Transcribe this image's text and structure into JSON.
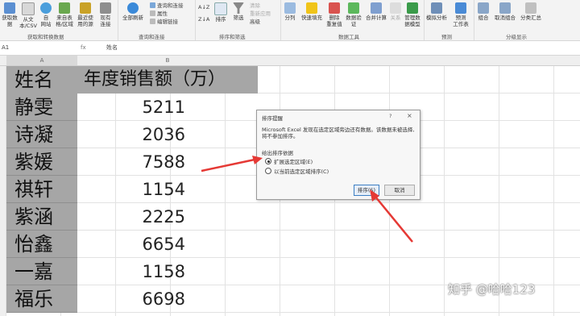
{
  "ribbon": {
    "groups": {
      "get_data": {
        "label": "获取和转换数据"
      },
      "queries": {
        "label": "查询和连接"
      },
      "sort_filter": {
        "label": "排序和筛选"
      },
      "data_tools": {
        "label": "数据工具"
      },
      "forecast": {
        "label": "预测"
      },
      "outline": {
        "label": "分级显示"
      }
    },
    "buttons": {
      "get_data": "获取数\n据",
      "from_text": "从文\n本/CSV",
      "from_web": "自\n网站",
      "from_table": "来自表\n格/区域",
      "recent": "最近使\n用的源",
      "existing": "现有\n连接",
      "refresh_all": "全部刷新",
      "queries_conn": "查询和连接",
      "properties": "属性",
      "edit_links": "编辑链接",
      "sort_asc": "A↓Z",
      "sort_desc": "Z↓A",
      "sort": "排序",
      "filter": "筛选",
      "clear": "清除",
      "reapply": "重新应用",
      "advanced": "高级",
      "text_to_cols": "分列",
      "flash_fill": "快速填充",
      "remove_dup": "删除\n重复值",
      "validation": "数据验\n证",
      "consolidate": "合并计算",
      "relations": "关系",
      "data_model": "管理数\n据模型",
      "what_if": "模拟分析",
      "forecast_sheet": "预测\n工作表",
      "group": "组合",
      "ungroup": "取消组合",
      "subtotal": "分类汇总"
    }
  },
  "formula_bar": {
    "cell_ref": "A1",
    "fx": "fx",
    "content": "姓名"
  },
  "columns": {
    "a": "A",
    "b": "B"
  },
  "table": {
    "header": {
      "name": "姓名",
      "sales": "年度销售额（万）"
    },
    "rows": [
      {
        "name": "静雯",
        "sales": "5211"
      },
      {
        "name": "诗凝",
        "sales": "2036"
      },
      {
        "name": "紫媛",
        "sales": "7588"
      },
      {
        "name": "祺轩",
        "sales": "1154"
      },
      {
        "name": "紫涵",
        "sales": "2225"
      },
      {
        "name": "怡鑫",
        "sales": "6654"
      },
      {
        "name": "一嘉",
        "sales": "1158"
      },
      {
        "name": "福乐",
        "sales": "6698"
      }
    ]
  },
  "dialog": {
    "title": "排序提醒",
    "help": "?",
    "close": "×",
    "message": "Microsoft Excel 发现在选定区域旁边还有数据。该数据未被选择,将不参加排序。",
    "group_label": "给出排序依据",
    "option_expand": "扩展选定区域(E)",
    "option_current": "以当前选定区域排序(C)",
    "sort_button": "排序(S)",
    "cancel_button": "取消"
  },
  "watermark": "知乎 @哈哈123",
  "colors": {
    "annotation_arrow": "#e53935",
    "selection_fill": "#a6a6a6",
    "primary_button_border": "#3c7fc4"
  }
}
